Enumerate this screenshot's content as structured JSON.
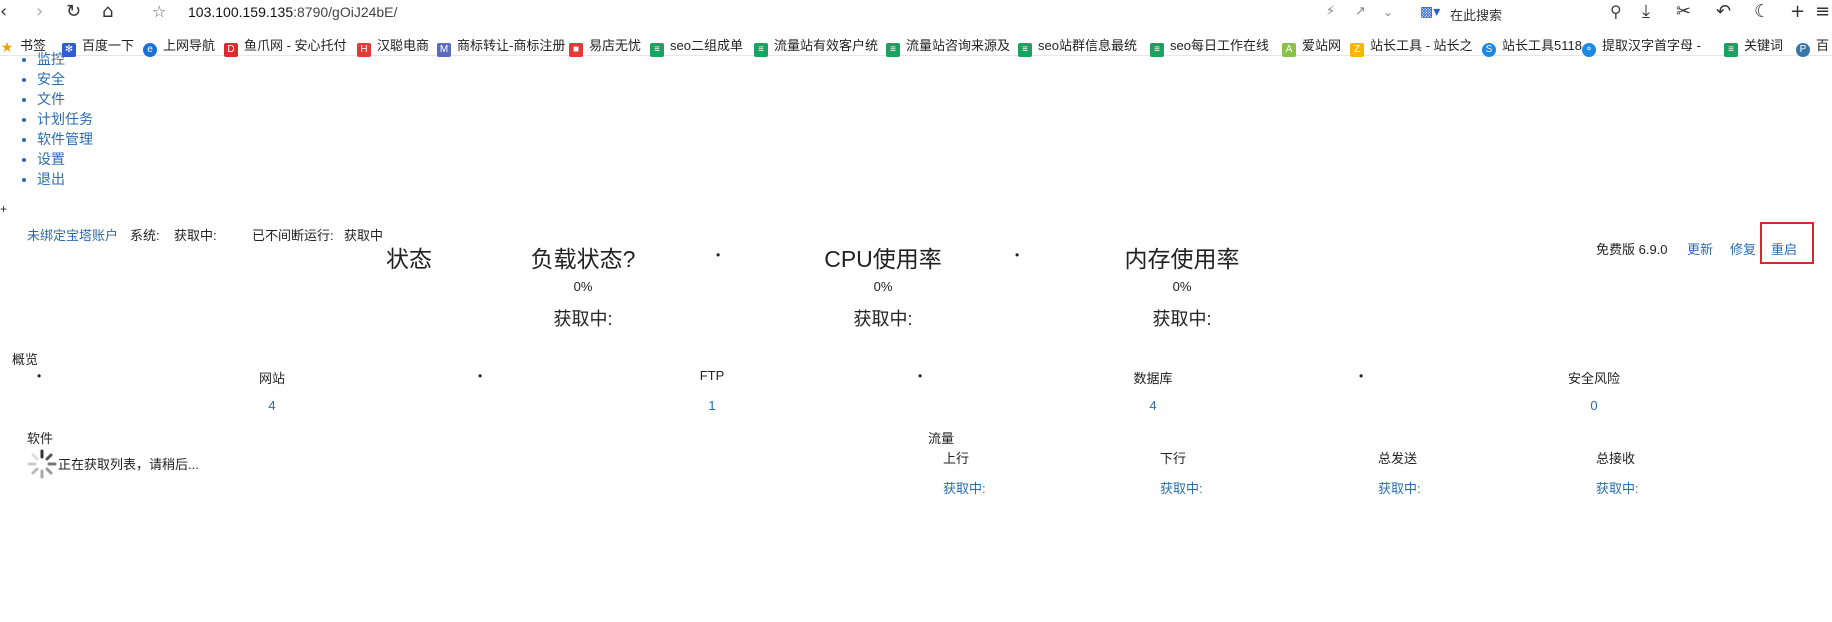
{
  "browser": {
    "url_host": "103.100.159.135",
    "url_rest": ":8790/gOiJ24bE/",
    "search_placeholder": "在此搜索"
  },
  "bookmarks": [
    {
      "label": "书签"
    },
    {
      "label": "百度一下"
    },
    {
      "label": "上网导航"
    },
    {
      "label": "鱼爪网 - 安心托付"
    },
    {
      "label": "汉聪电商"
    },
    {
      "label": "商标转让-商标注册"
    },
    {
      "label": "易店无忧"
    },
    {
      "label": "seo二组成单"
    },
    {
      "label": "流量站有效客户统"
    },
    {
      "label": "流量站咨询来源及"
    },
    {
      "label": "seo站群信息最统"
    },
    {
      "label": "seo每日工作在线"
    },
    {
      "label": "爱站网"
    },
    {
      "label": "站长工具 - 站长之"
    },
    {
      "label": "站长工具5118"
    },
    {
      "label": "提取汉字首字母 -"
    },
    {
      "label": "关键词"
    },
    {
      "label": "百"
    }
  ],
  "menu": [
    "监控",
    "安全",
    "文件",
    "计划任务",
    "软件管理",
    "设置",
    "退出"
  ],
  "plus": "+",
  "status_bar": {
    "unbound_account": "未绑定宝塔账户",
    "system_label": "系统:",
    "system_value": "获取中:",
    "uptime_label": "已不间断运行:",
    "uptime_value": "获取中"
  },
  "version": {
    "label": "免费版 6.9.0",
    "update": "更新",
    "repair": "修复",
    "restart": "重启"
  },
  "status_panel": {
    "title": "状态",
    "bullet": "•",
    "gauges": [
      {
        "title": "负载状态",
        "help": "?",
        "value": "0%",
        "status": "获取中:"
      },
      {
        "title": "CPU使用率",
        "value": "0%",
        "status": "获取中:"
      },
      {
        "title": "内存使用率",
        "value": "0%",
        "status": "获取中:"
      }
    ]
  },
  "overview": {
    "title": "概览",
    "items": [
      {
        "label": "网站",
        "value": "4"
      },
      {
        "label": "FTP",
        "value": "1"
      },
      {
        "label": "数据库",
        "value": "4"
      },
      {
        "label": "安全风险",
        "value": "0"
      }
    ]
  },
  "software": {
    "title": "软件",
    "loading": "正在获取列表，请稍后..."
  },
  "traffic": {
    "title": "流量",
    "columns": [
      {
        "label": "上行",
        "value": "获取中:"
      },
      {
        "label": "下行",
        "value": "获取中:"
      },
      {
        "label": "总发送",
        "value": "获取中:"
      },
      {
        "label": "总接收",
        "value": "获取中:"
      }
    ]
  },
  "colors": {
    "link": "#2b6cb0",
    "highlight_border": "#d9272e"
  }
}
